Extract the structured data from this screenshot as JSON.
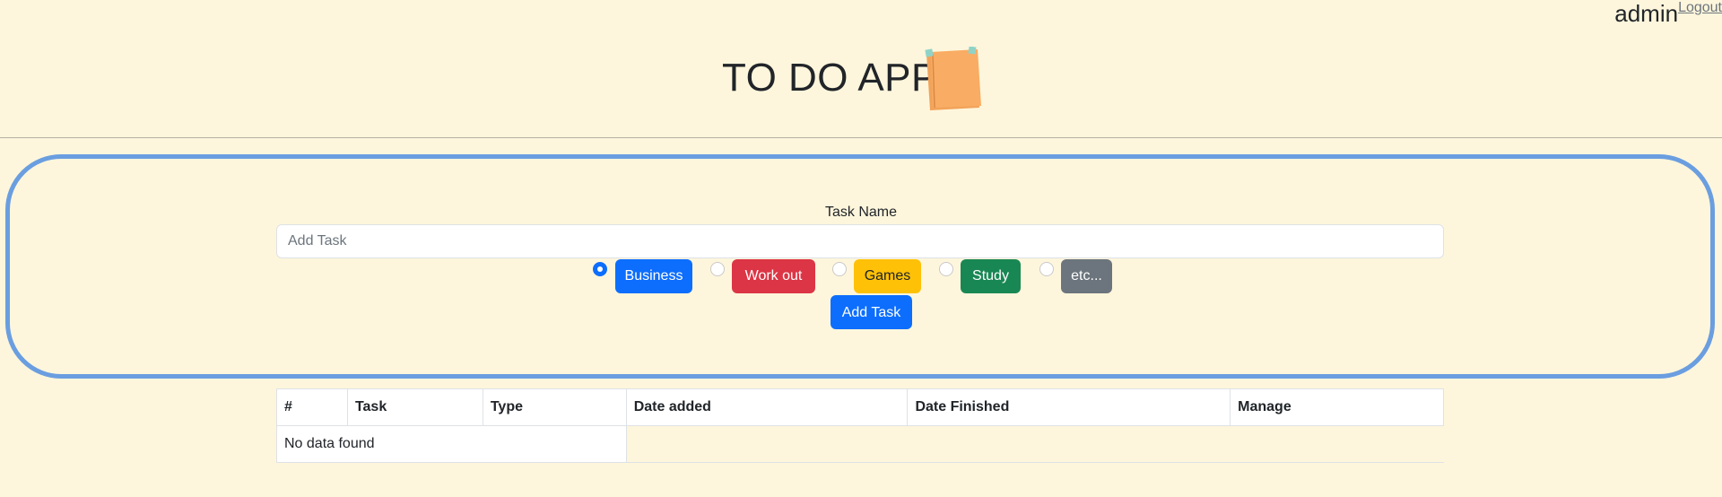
{
  "user": {
    "name": "admin",
    "logout_label": "Logout"
  },
  "header": {
    "title": "TO DO APP",
    "icon": "sticky-note-icon"
  },
  "form": {
    "label": "Task Name",
    "placeholder": "Add Task",
    "value": "",
    "types": [
      {
        "label": "Business",
        "color": "#0d6efd",
        "selected": true
      },
      {
        "label": "Work out",
        "color": "#dc3545",
        "selected": false
      },
      {
        "label": "Games",
        "color": "#ffc107",
        "selected": false
      },
      {
        "label": "Study",
        "color": "#198754",
        "selected": false
      },
      {
        "label": "etc...",
        "color": "#6c757d",
        "selected": false
      }
    ],
    "submit_label": "Add Task"
  },
  "table": {
    "columns": [
      "#",
      "Task",
      "Type",
      "Date added",
      "Date Finished",
      "Manage"
    ],
    "empty_message": "No data found"
  },
  "colors": {
    "background": "#fef6dc",
    "panel_border": "#6a9ee0",
    "primary": "#0d6efd"
  }
}
